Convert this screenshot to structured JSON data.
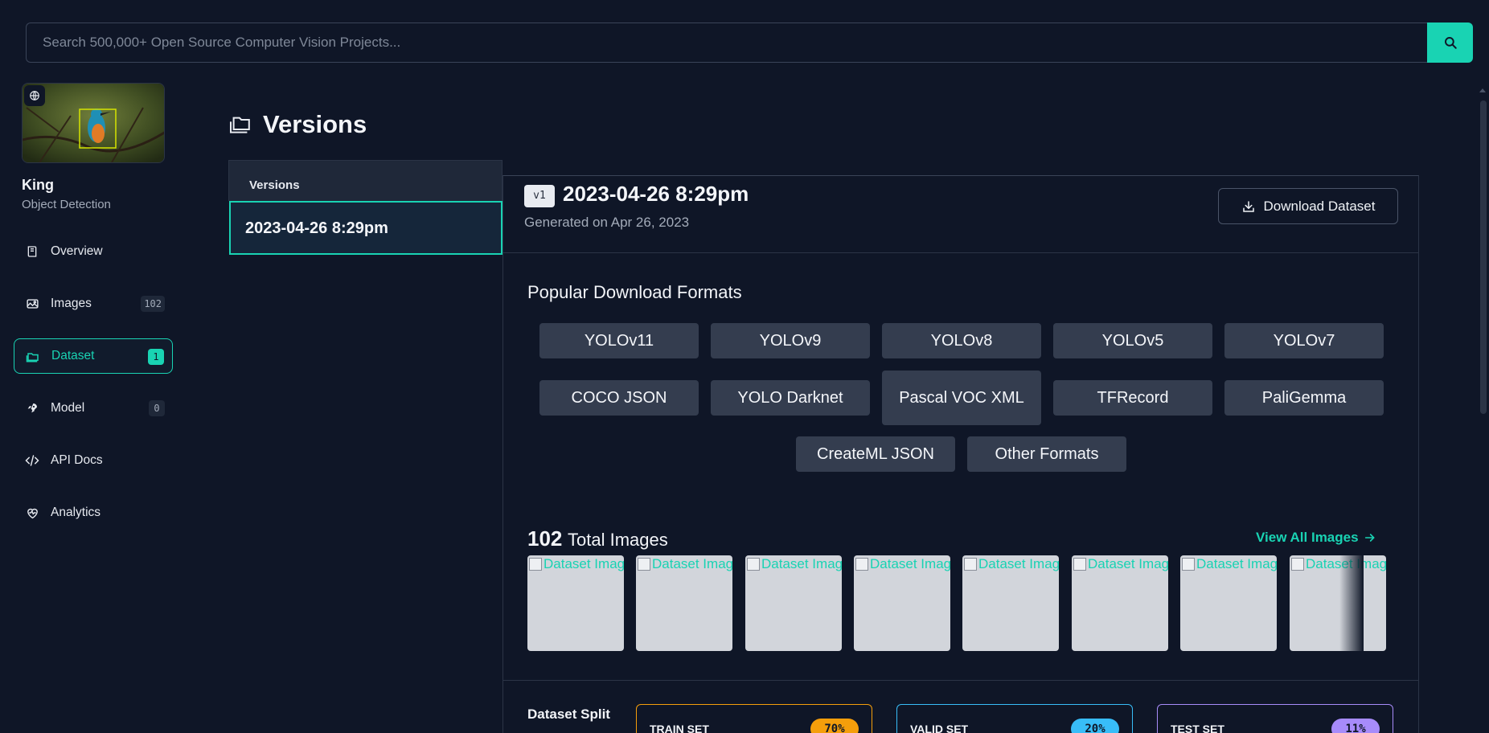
{
  "search": {
    "placeholder": "Search 500,000+ Open Source Computer Vision Projects..."
  },
  "project": {
    "name": "King",
    "type": "Object Detection"
  },
  "sidebar": {
    "items": [
      {
        "label": "Overview",
        "icon": "book-icon"
      },
      {
        "label": "Images",
        "icon": "image-icon",
        "count": "102"
      },
      {
        "label": "Dataset",
        "icon": "folder-icon",
        "count": "1",
        "active": true
      },
      {
        "label": "Model",
        "icon": "rocket-icon",
        "count": "0"
      },
      {
        "label": "API Docs",
        "icon": "code-icon"
      },
      {
        "label": "Analytics",
        "icon": "heart-pulse-icon"
      }
    ]
  },
  "page": {
    "title": "Versions"
  },
  "versions": {
    "header": "Versions",
    "items": [
      "2023-04-26 8:29pm"
    ]
  },
  "version_detail": {
    "tag": "v1",
    "title": "2023-04-26 8:29pm",
    "generated": "Generated on Apr 26, 2023",
    "download_label": "Download Dataset"
  },
  "formats": {
    "title": "Popular Download Formats",
    "items": [
      "YOLOv11",
      "YOLOv9",
      "YOLOv8",
      "YOLOv5",
      "YOLOv7",
      "COCO JSON",
      "YOLO Darknet",
      "Pascal VOC XML",
      "TFRecord",
      "PaliGemma",
      "CreateML JSON",
      "Other Formats"
    ]
  },
  "images": {
    "count": "102",
    "label": "Total Images",
    "view_all": "View All Images",
    "thumb_alt": "Dataset Image Annotation"
  },
  "split": {
    "title": "Dataset Split",
    "sets": [
      {
        "label": "TRAIN SET",
        "pct": "70%",
        "color": "#f59e0b"
      },
      {
        "label": "VALID SET",
        "pct": "20%",
        "color": "#38bdf8"
      },
      {
        "label": "TEST SET",
        "pct": "11%",
        "color": "#a78bfa"
      }
    ]
  },
  "colors": {
    "accent": "#19d3b3",
    "background": "#0f1627"
  }
}
